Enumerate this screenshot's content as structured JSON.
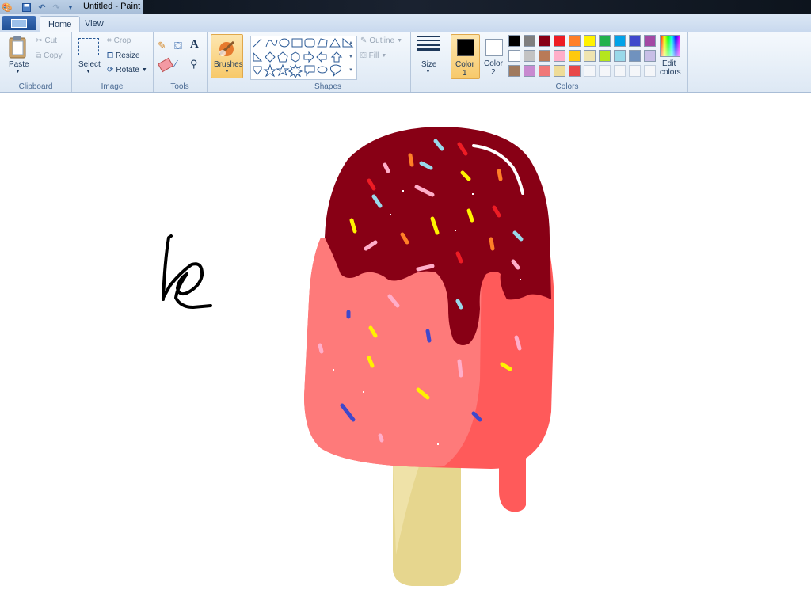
{
  "window": {
    "title": "Untitled - Paint"
  },
  "quick_access": {
    "icons": [
      "save-icon",
      "undo-icon",
      "redo-icon",
      "customize-icon"
    ]
  },
  "tabs": [
    {
      "label": "Home"
    },
    {
      "label": "View"
    }
  ],
  "ribbon": {
    "clipboard": {
      "label": "Clipboard",
      "paste": "Paste",
      "cut": "Cut",
      "copy": "Copy"
    },
    "image": {
      "label": "Image",
      "select": "Select",
      "crop": "Crop",
      "resize": "Resize",
      "rotate": "Rotate"
    },
    "tools": {
      "label": "Tools"
    },
    "brushes": {
      "label": "Brushes"
    },
    "shapes": {
      "label": "Shapes",
      "outline": "Outline",
      "fill": "Fill"
    },
    "size": {
      "label": "Size"
    },
    "colors": {
      "label": "Colors",
      "color1": "Color",
      "color1_num": "1",
      "color2": "Color",
      "color2_num": "2",
      "edit": "Edit",
      "edit2": "colors",
      "palette": [
        "#000000",
        "#7f7f7f",
        "#880015",
        "#ed1c24",
        "#ff7f27",
        "#fff200",
        "#22b14c",
        "#00a2e8",
        "#3f48cc",
        "#a349a4",
        "#ffffff",
        "#c3c3c3",
        "#b97a57",
        "#ffaec9",
        "#ffc90e",
        "#efe4b0",
        "#b5e61d",
        "#99d9ea",
        "#7092be",
        "#c8bfe7",
        "#a07a5e",
        "#c88ad0",
        "#f07878",
        "#eedc98",
        "#e84848"
      ]
    }
  },
  "canvas": {
    "drawing": "popsicle",
    "colors": {
      "stick": "#e6d68e",
      "body": "#ff5a5a",
      "body_light": "#fe7a7a",
      "chocolate": "#880015"
    }
  }
}
